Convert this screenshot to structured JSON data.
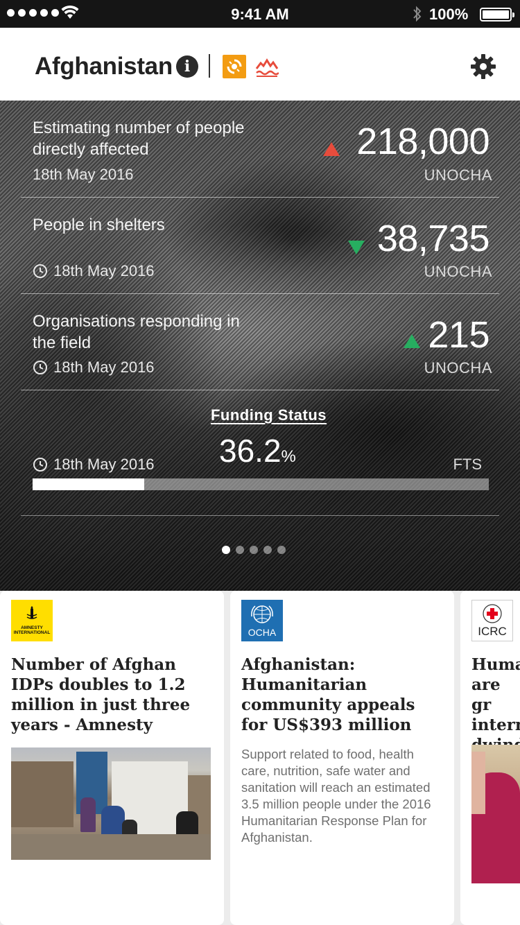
{
  "status_bar": {
    "time": "9:41 AM",
    "battery": "100%"
  },
  "header": {
    "title": "Afghanistan",
    "info_icon": "i"
  },
  "stats": [
    {
      "label": "Estimating number of people directly affected",
      "date": "18th May 2016",
      "value": "218,000",
      "source": "UNOCHA",
      "trend": "up",
      "trend_color": "#e74c3c",
      "show_clock": false
    },
    {
      "label": "People in shelters",
      "date": "18th May 2016",
      "value": "38,735",
      "source": "UNOCHA",
      "trend": "down",
      "trend_color": "#27ae60",
      "show_clock": true
    },
    {
      "label": "Organisations responding in the field",
      "date": "18th May 2016",
      "value": "215",
      "source": "UNOCHA",
      "trend": "up",
      "trend_color": "#27ae60",
      "show_clock": true
    }
  ],
  "funding": {
    "title": "Funding Status",
    "value": "36.2",
    "unit": "%",
    "date": "18th May 2016",
    "source": "FTS",
    "progress_fraction": 0.245
  },
  "pager": {
    "count": 5,
    "active": 0
  },
  "cards": [
    {
      "logo": "amnesty-logo",
      "logo_text": "AMNESTY INTERNATIONAL",
      "headline": "Number of Afghan IDPs doubles to 1.2 million in just three years - Amnesty",
      "body": ""
    },
    {
      "logo": "ocha-logo",
      "logo_text": "OCHA",
      "headline": "Afghanistan: Humanitarian community appeals for US$393 million",
      "body": "Support related to food, health care, nutrition, safe water and sanitation will reach an estimated 3.5 million people under the 2016 Humanitarian Response Plan for Afghanistan."
    },
    {
      "logo": "icrc-logo",
      "logo_text": "ICRC",
      "headline": "Huma are gr intern dwind",
      "body": ""
    }
  ],
  "colors": {
    "crisis_icon": "#f39c12",
    "flood_icon": "#e74c3c",
    "amnesty_yellow": "#ffde00",
    "ocha_blue": "#1f6fb2"
  }
}
